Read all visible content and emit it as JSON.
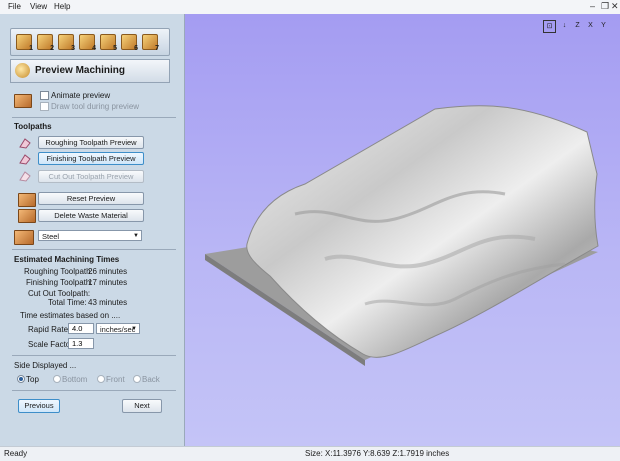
{
  "menu": [
    "File",
    "View",
    "Help"
  ],
  "toolbar_icons": [
    {
      "name": "step-1-icon",
      "num": "1"
    },
    {
      "name": "step-2-icon",
      "num": "2"
    },
    {
      "name": "step-3-icon",
      "num": "3"
    },
    {
      "name": "step-4-icon",
      "num": "4"
    },
    {
      "name": "step-5-icon",
      "num": "5"
    },
    {
      "name": "step-6-icon",
      "num": "6"
    },
    {
      "name": "step-7-icon",
      "num": "7"
    }
  ],
  "panel": {
    "title": "Preview Machining",
    "animate_label": "Animate preview",
    "draw_tool_label": "Draw tool during preview",
    "toolpaths_header": "Toolpaths",
    "roughing_btn": "Roughing Toolpath Preview",
    "finishing_btn": "Finishing Toolpath Preview",
    "cutout_btn": "Cut Out Toolpath Preview",
    "reset_btn": "Reset Preview",
    "delete_btn": "Delete Waste Material",
    "material": "Steel",
    "times_header": "Estimated Machining Times",
    "times": [
      {
        "label": "Roughing Toolpath:",
        "value": "26 minutes"
      },
      {
        "label": "Finishing Toolpath:",
        "value": "17 minutes"
      },
      {
        "label": "Cut Out Toolpath:",
        "value": ""
      },
      {
        "label": "Total Time:",
        "value": "43 minutes"
      }
    ],
    "estimates_note": "Time estimates based on ....",
    "rapid_rate_label": "Rapid Rate",
    "rapid_rate_value": "4.0",
    "rapid_rate_unit": "inches/sec",
    "scale_factor_label": "Scale Factor",
    "scale_factor_value": "1.3",
    "side_label": "Side Displayed ...",
    "sides": [
      "Top",
      "Bottom",
      "Front",
      "Back"
    ],
    "selected_side": "Top",
    "previous_btn": "Previous",
    "next_btn": "Next"
  },
  "view_buttons": [
    "⊡",
    "↓",
    "Z",
    "X",
    "Y"
  ],
  "status": {
    "left": "Ready",
    "size": "Size: X:11.3976 Y:8.639 Z:1.7919 inches"
  }
}
